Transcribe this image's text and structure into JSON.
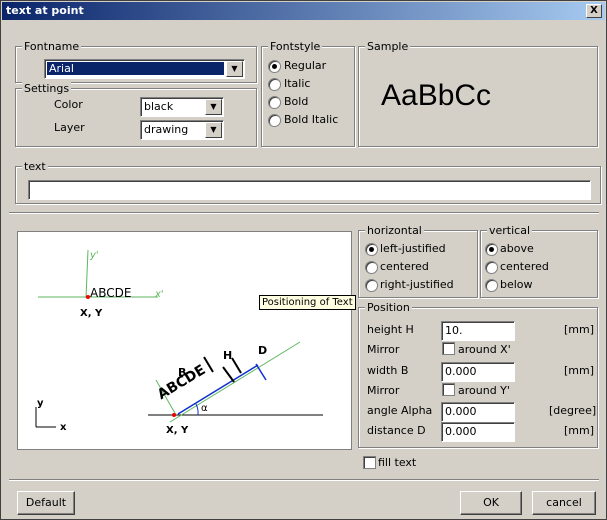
{
  "window": {
    "title": "text at point",
    "close_label": "X"
  },
  "fontname": {
    "legend": "Fontname",
    "value": "Arial"
  },
  "settings": {
    "legend": "Settings",
    "color_label": "Color",
    "color_value": "black",
    "layer_label": "Layer",
    "layer_value": "drawing"
  },
  "fontstyle": {
    "legend": "Fontstyle",
    "options": [
      "Regular",
      "Italic",
      "Bold",
      "Bold Italic"
    ],
    "selected": "Regular"
  },
  "sample": {
    "legend": "Sample",
    "preview": "AaBbCc"
  },
  "text_field": {
    "legend": "text",
    "value": ""
  },
  "diagram": {
    "upper_label": "ABCDE",
    "upper_xy": "X, Y",
    "y_prime": "y'",
    "x_prime": "x'",
    "lower_label": "ABCDE",
    "lower_xy": "X, Y",
    "axis_y": "y",
    "axis_x": "x",
    "B": "B",
    "H": "H",
    "D": "D",
    "alpha": "α"
  },
  "tooltip": "Positioning of Text",
  "horizontal": {
    "legend": "horizontal",
    "options": [
      "left-justified",
      "centered",
      "right-justified"
    ],
    "selected": "left-justified"
  },
  "vertical": {
    "legend": "vertical",
    "options": [
      "above",
      "centered",
      "below"
    ],
    "selected": "above"
  },
  "position": {
    "legend": "Position",
    "height_label": "height  H",
    "height_value": "10.",
    "height_unit": "[mm]",
    "mirror1_label": "Mirror",
    "mirror1_check": "around X'",
    "width_label": "width  B",
    "width_value": "0.000",
    "width_unit": "[mm]",
    "mirror2_label": "Mirror",
    "mirror2_check": "around Y'",
    "angle_label": "angle  Alpha",
    "angle_value": "0.000",
    "angle_unit": "[degree]",
    "distance_label": "distance  D",
    "distance_value": "0.000",
    "distance_unit": "[mm]"
  },
  "fill_text": {
    "label": "fill text",
    "checked": false
  },
  "buttons": {
    "default": "Default",
    "ok": "OK",
    "cancel": "cancel"
  }
}
